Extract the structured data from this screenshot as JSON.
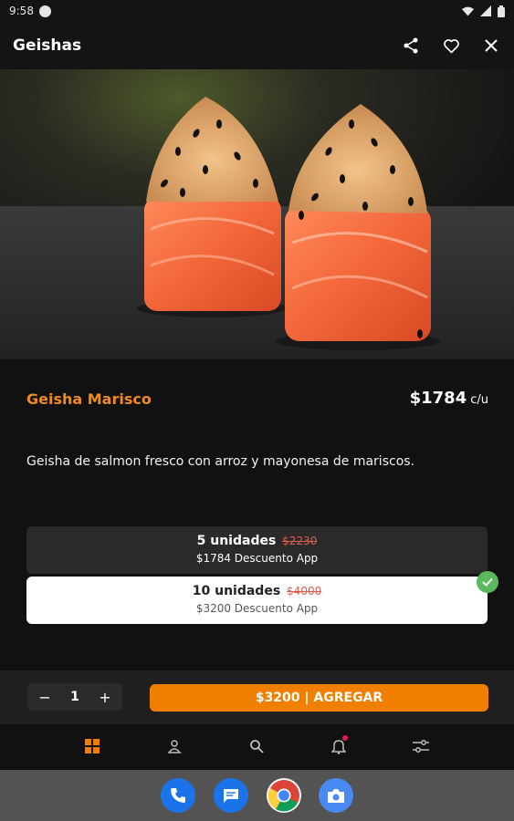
{
  "status_bar": {
    "time": "9:58"
  },
  "app_bar": {
    "title": "Geishas"
  },
  "product": {
    "name": "Geisha Marisco",
    "price": "$1784",
    "price_unit": "c/u",
    "description": "Geisha de salmon fresco con arroz y mayonesa de mariscos."
  },
  "options": [
    {
      "title": "5 unidades",
      "old_price": "$2230",
      "detail": "$1784 Descuento App",
      "selected": false
    },
    {
      "title": "10 unidades",
      "old_price": "$4000",
      "detail": "$3200 Descuento App",
      "selected": true
    }
  ],
  "cart": {
    "quantity": "1",
    "minus": "−",
    "plus": "+",
    "add_label": "$3200 | AGREGAR"
  },
  "bottom_nav": [
    {
      "icon": "grid-icon",
      "active": true
    },
    {
      "icon": "user-icon",
      "active": false
    },
    {
      "icon": "search-icon",
      "active": false
    },
    {
      "icon": "bell-icon",
      "active": false,
      "has_badge": true
    },
    {
      "icon": "filters-icon",
      "active": false
    }
  ],
  "dock": [
    "phone-icon",
    "messages-icon",
    "chrome-icon",
    "camera-icon"
  ],
  "colors": {
    "accent": "#f07f00",
    "product_name": "#f08a1c",
    "background": "#111111",
    "selected_check": "#5cb85c",
    "strike_price": "#e05a4f"
  }
}
